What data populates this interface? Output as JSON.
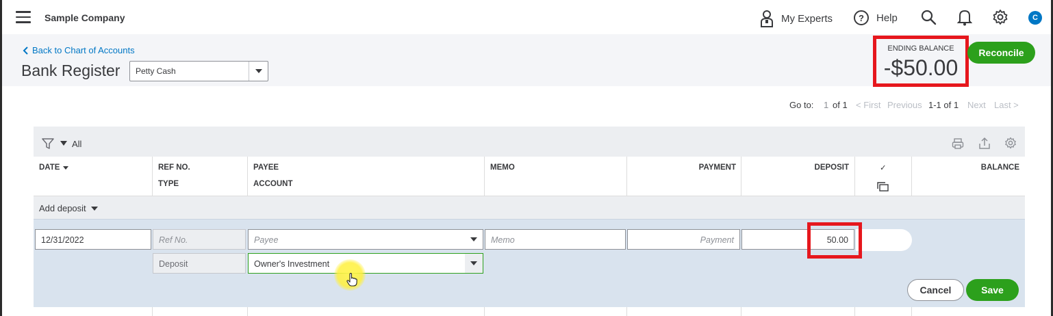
{
  "topbar": {
    "company_name": "Sample Company",
    "my_experts_label": "My Experts",
    "help_label": "Help",
    "avatar_letter": "C",
    "avatar_color": "#0077c5"
  },
  "subheader": {
    "back_link": "Back to Chart of Accounts",
    "page_title": "Bank Register",
    "account_selected": "Petty Cash",
    "ending_balance_label": "ENDING BALANCE",
    "ending_balance_value": "-$50.00",
    "reconcile_label": "Reconcile"
  },
  "paging": {
    "goto_label": "Go to:",
    "page_current": "1",
    "page_of": "of 1",
    "first": "< First",
    "previous": "Previous",
    "range": "1-1 of 1",
    "next": "Next",
    "last": "Last >"
  },
  "toolbar": {
    "filter_label": "All"
  },
  "columns": {
    "date": "DATE",
    "ref_no": "REF NO.",
    "type": "TYPE",
    "payee": "PAYEE",
    "account": "ACCOUNT",
    "memo": "MEMO",
    "payment": "PAYMENT",
    "deposit": "DEPOSIT",
    "cleared": "✓",
    "balance": "BALANCE"
  },
  "add_deposit_label": "Add deposit",
  "edit_row": {
    "date": "12/31/2022",
    "ref_placeholder": "Ref No.",
    "payee_placeholder": "Payee",
    "memo_placeholder": "Memo",
    "payment_placeholder": "Payment",
    "deposit_value": "50.00",
    "type": "Deposit",
    "account": "Owner's Investment",
    "cancel_label": "Cancel",
    "save_label": "Save"
  },
  "colors": {
    "brand_green": "#2ca01c",
    "link_blue": "#0077c5",
    "highlight_red": "#e6171d"
  }
}
